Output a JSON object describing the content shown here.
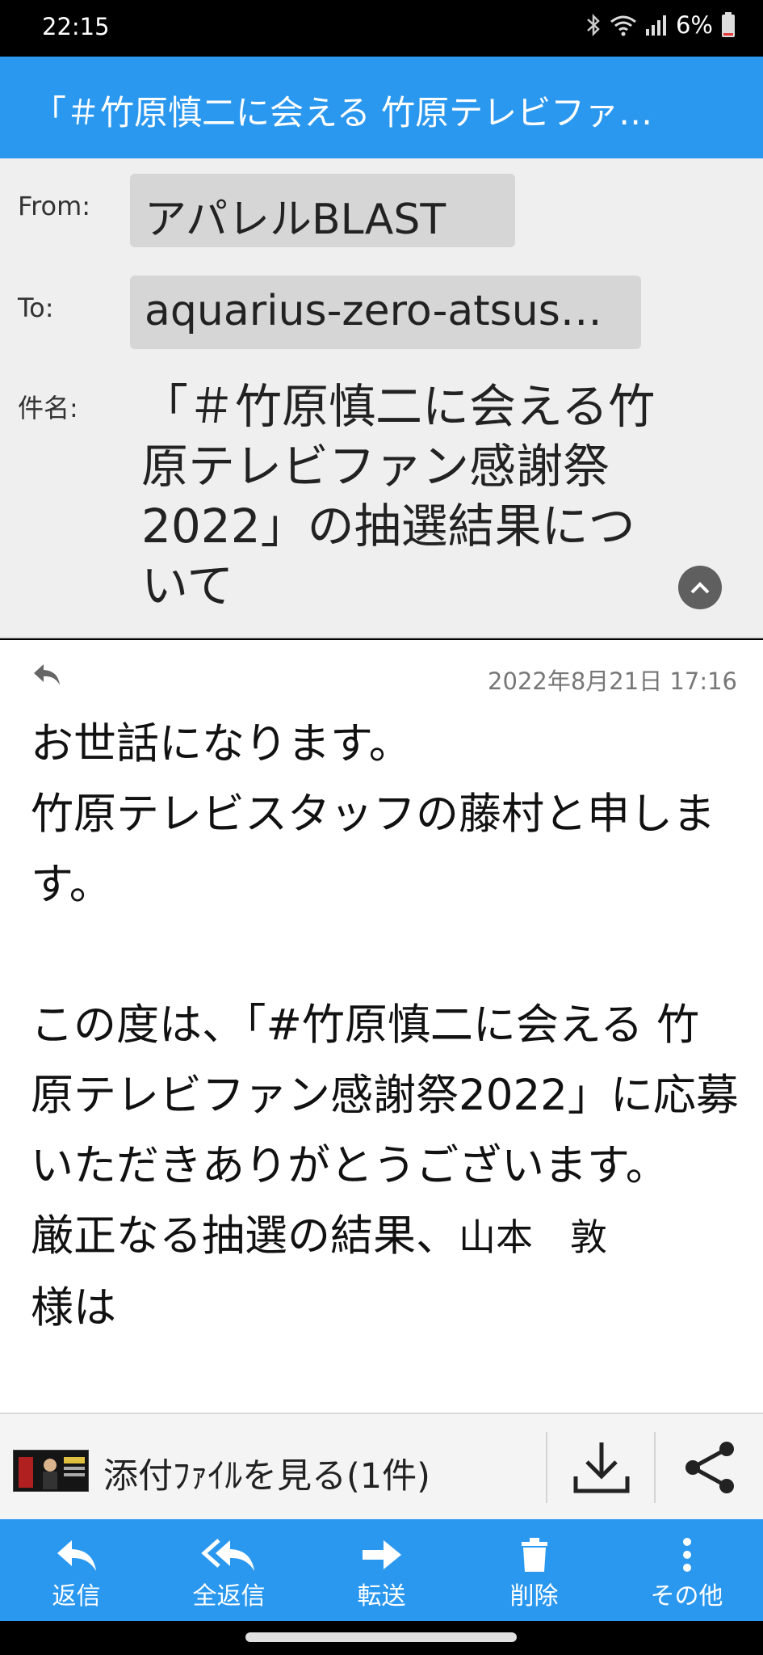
{
  "status_bar": {
    "time": "22:15",
    "battery": "6%",
    "icons": [
      "bluetooth-icon",
      "wifi-icon",
      "signal-icon",
      "battery-icon"
    ]
  },
  "title_bar": {
    "title": "「＃竹原慎二に会える 竹原テレビファ…"
  },
  "header": {
    "from_label": "From:",
    "from_value": "アパレルBLAST",
    "to_label": "To:",
    "to_value": "aquarius-zero-atsus…",
    "subject_label": "件名:",
    "subject_value": "「＃竹原慎二に会える竹原テレビファン感謝祭2022」の抽選結果について"
  },
  "message": {
    "date": "2022年8月21日 17:16",
    "body_main": "お世話になります。\n竹原テレビスタッフの藤村と申します。\n\nこの度は、「#竹原慎二に会える 竹原テレビファン感謝祭2022」に応募いただきありがとうございます。\n厳正なる抽選の結果、",
    "body_name": "山本　敦",
    "body_after": "様は"
  },
  "attachment": {
    "label": "添付ﾌｧｲﾙを見る(1件)"
  },
  "bottom_nav": {
    "reply": "返信",
    "reply_all": "全返信",
    "forward": "転送",
    "delete": "削除",
    "more": "その他"
  },
  "colors": {
    "accent": "#2b98f0",
    "header_bg": "#efefef",
    "chip_bg": "#d6d6d6"
  }
}
